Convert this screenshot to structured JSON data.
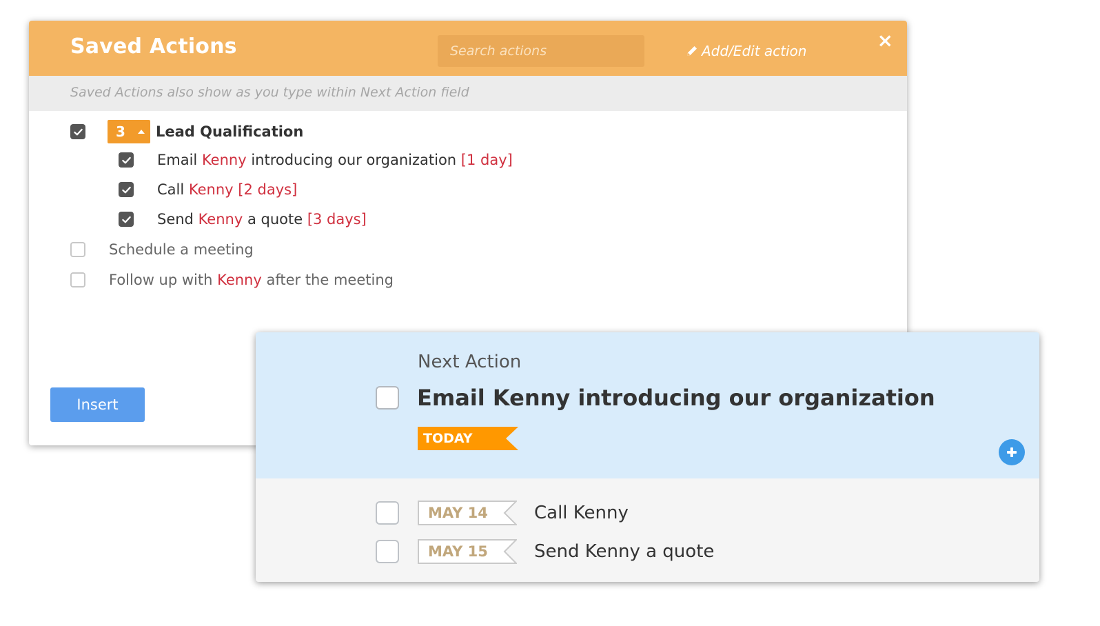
{
  "modal": {
    "title": "Saved Actions",
    "search_placeholder": "Search actions",
    "add_edit_label": "Add/Edit action",
    "close_label": "×",
    "hint": "Saved Actions also show as you type within Next Action field",
    "group": {
      "checked": true,
      "count": "3",
      "title": "Lead Qualification",
      "items": [
        {
          "checked": true,
          "before": "Email ",
          "name": "Kenny",
          "after": " introducing our organization ",
          "days": "[1 day]"
        },
        {
          "checked": true,
          "before": "Call ",
          "name": "Kenny",
          "after": " ",
          "days": "[2 days]"
        },
        {
          "checked": true,
          "before": "Send ",
          "name": "Kenny",
          "after": " a quote ",
          "days": "[3 days]"
        }
      ]
    },
    "other_items": [
      {
        "checked": false,
        "before": "Schedule a meeting",
        "name": "",
        "after": ""
      },
      {
        "checked": false,
        "before": "Follow up with ",
        "name": "Kenny",
        "after": " after the meeting"
      }
    ],
    "insert_label": "Insert"
  },
  "next_action": {
    "label": "Next Action",
    "title": "Email Kenny introducing our organization",
    "due_tag": "TODAY",
    "upcoming": [
      {
        "date": "MAY 14",
        "text": "Call Kenny"
      },
      {
        "date": "MAY 15",
        "text": "Send Kenny a quote"
      }
    ]
  },
  "colors": {
    "header": "#f4b562",
    "badge": "#f29b2b",
    "name_highlight": "#d0303f",
    "insert_button": "#5b9ded",
    "next_action_bg": "#d9ecfb",
    "today_tag": "#ff9800",
    "plus_button": "#3d9be8"
  },
  "icons": {
    "checkbox": "checkmark-icon",
    "edit": "pencil-icon",
    "close": "close-icon",
    "expand": "caret-up-icon",
    "add": "plus-icon"
  }
}
